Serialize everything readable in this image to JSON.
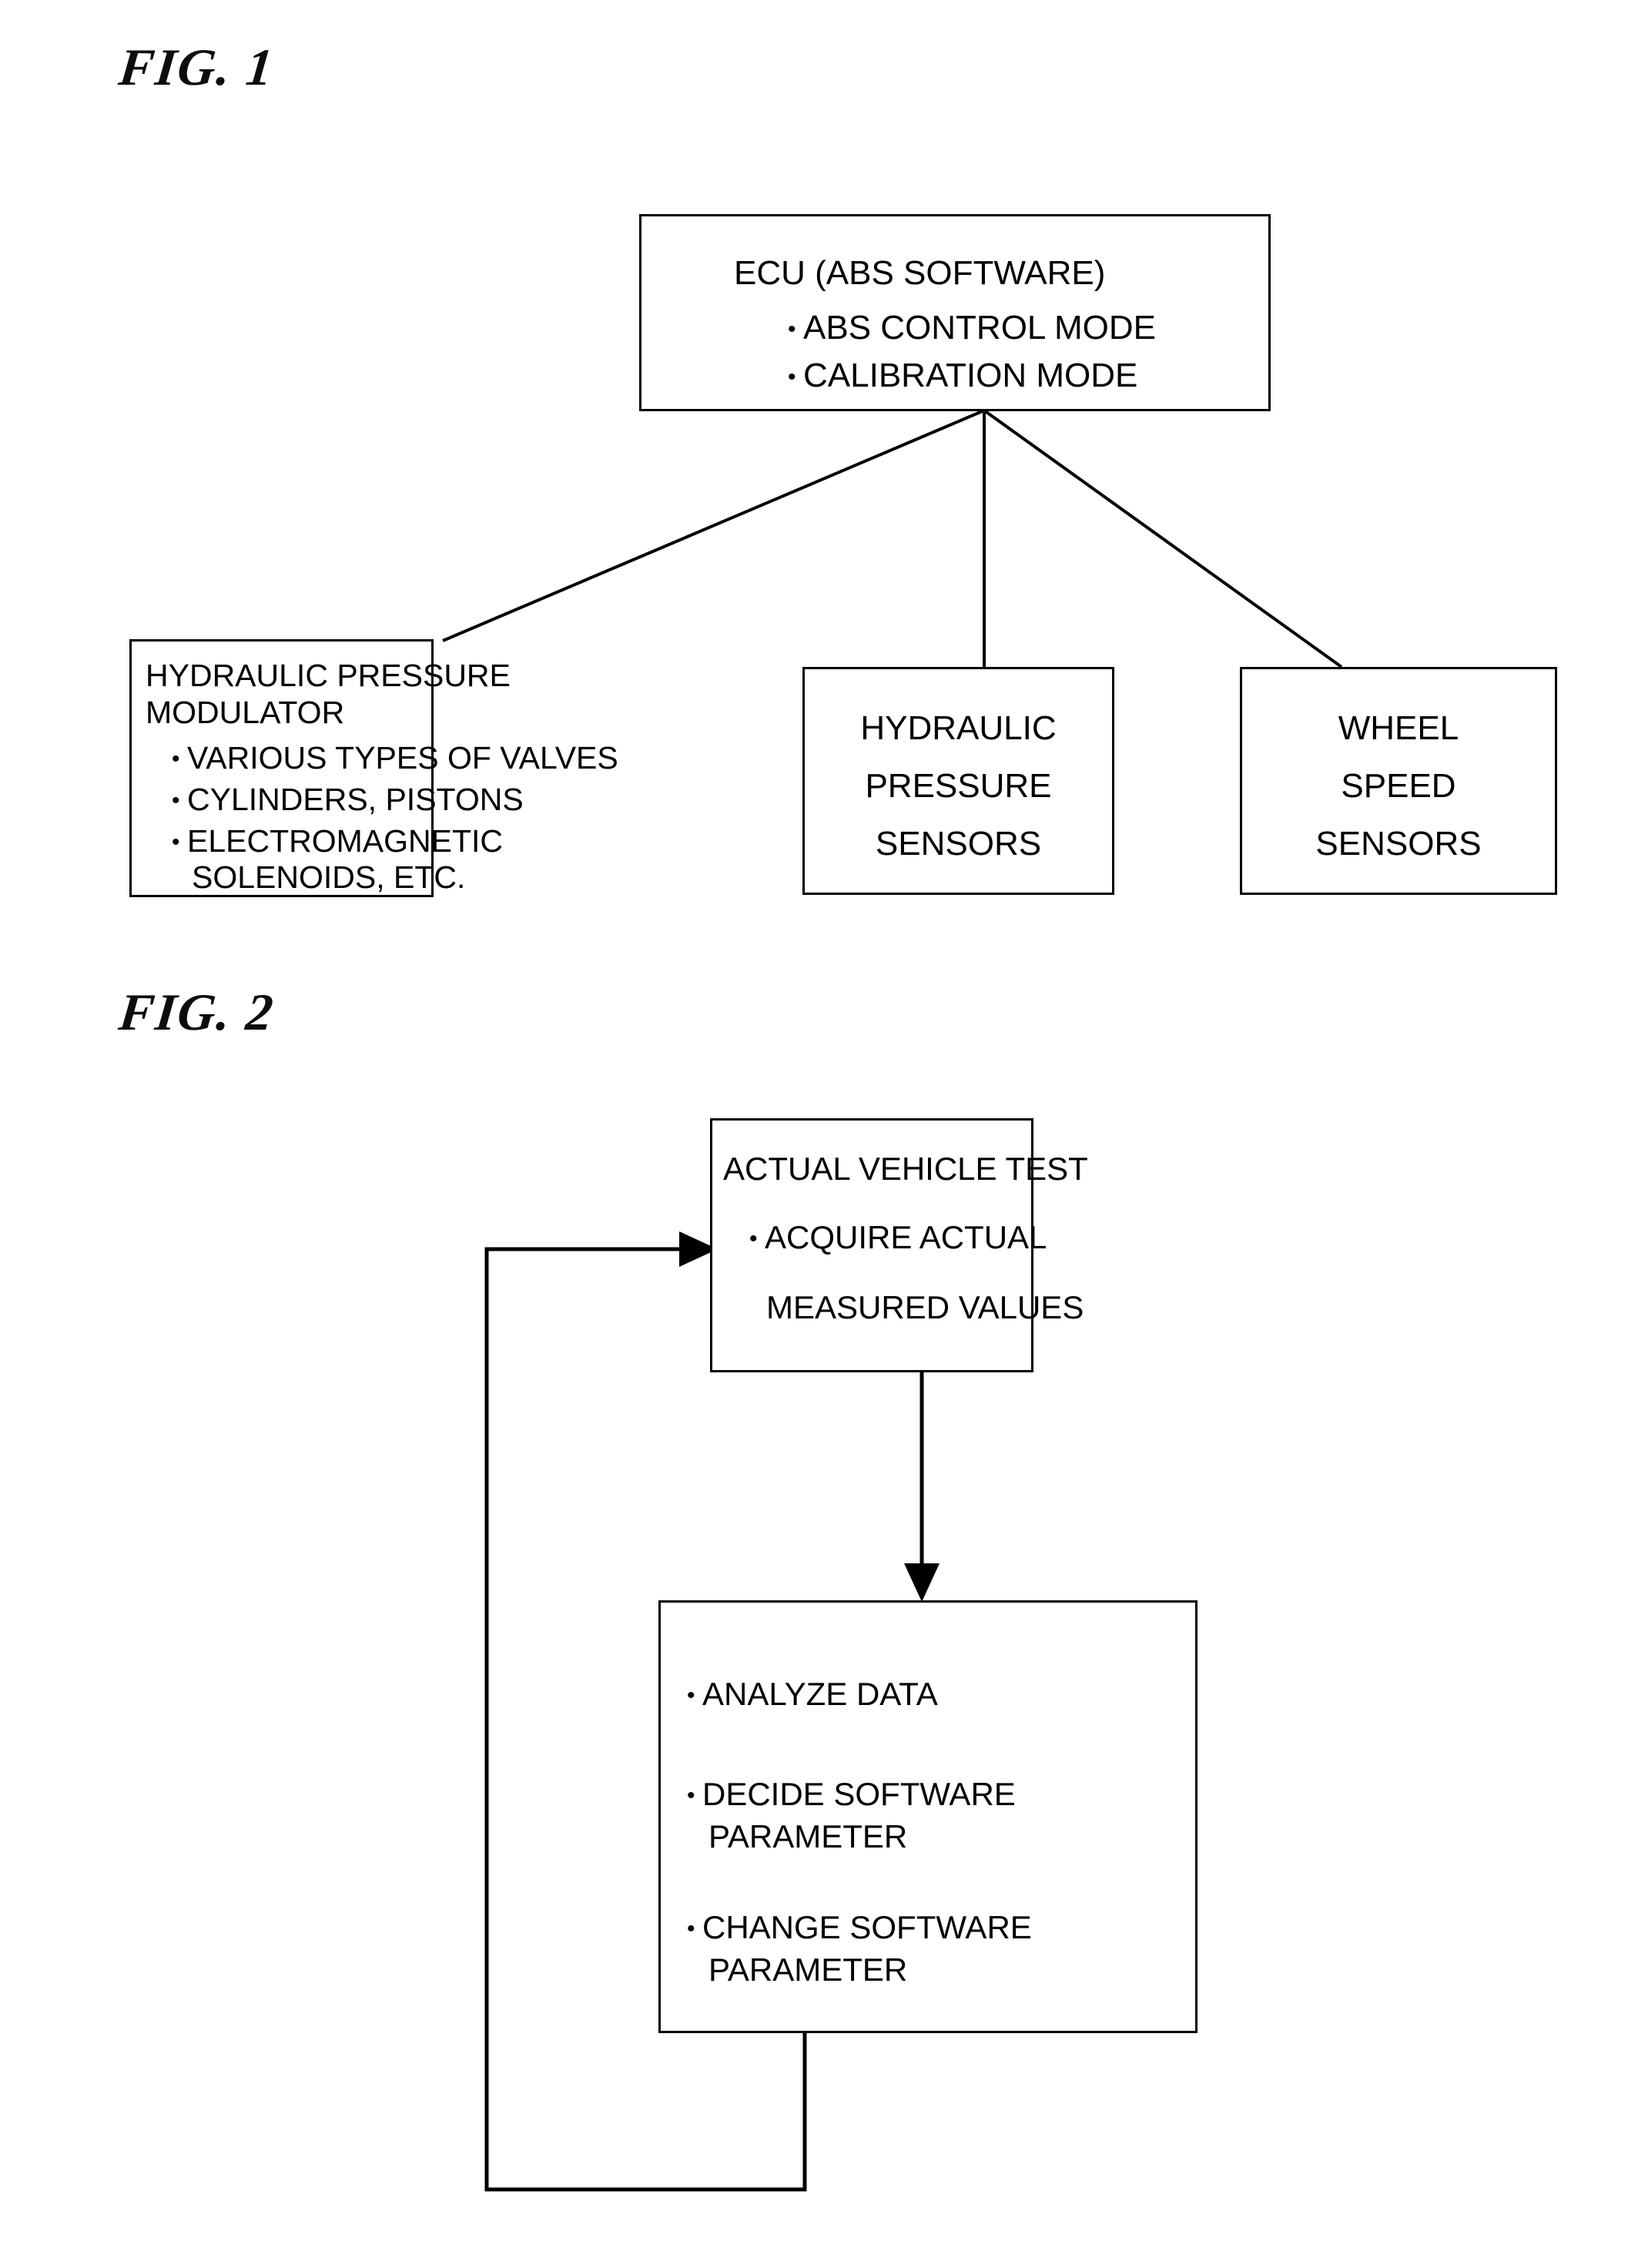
{
  "figures": [
    {
      "label": "FIG. 1",
      "boxes": {
        "ecu": {
          "title": "ECU (ABS SOFTWARE)",
          "bullets": [
            "ABS CONTROL MODE",
            "CALIBRATION MODE"
          ]
        },
        "modulator": {
          "title_line1": "HYDRAULIC PRESSURE",
          "title_line2": "MODULATOR",
          "bullets": [
            {
              "text": "VARIOUS TYPES OF VALVES",
              "cont": ""
            },
            {
              "text": "CYLINDERS, PISTONS",
              "cont": ""
            },
            {
              "text": "ELECTROMAGNETIC",
              "cont": "SOLENOIDS, ETC."
            }
          ]
        },
        "pressure_sensors": {
          "line1": "HYDRAULIC",
          "line2": "PRESSURE",
          "line3": "SENSORS"
        },
        "wheel_sensors": {
          "line1": "WHEEL",
          "line2": "SPEED",
          "line3": "SENSORS"
        }
      }
    },
    {
      "label": "FIG. 2",
      "boxes": {
        "vehicle_test": {
          "title": "ACTUAL VEHICLE TEST",
          "bullet1_line1": "ACQUIRE ACTUAL",
          "bullet1_line2": "MEASURED VALUES"
        },
        "analyze": {
          "bullets": [
            {
              "text": "ANALYZE DATA",
              "cont": ""
            },
            {
              "text": "DECIDE SOFTWARE",
              "cont": "PARAMETER"
            },
            {
              "text": "CHANGE SOFTWARE",
              "cont": "PARAMETER"
            }
          ]
        }
      }
    }
  ],
  "glyphs": {
    "bullet": "•"
  },
  "colors": {
    "ink": "#000000",
    "paper": "#ffffff"
  }
}
